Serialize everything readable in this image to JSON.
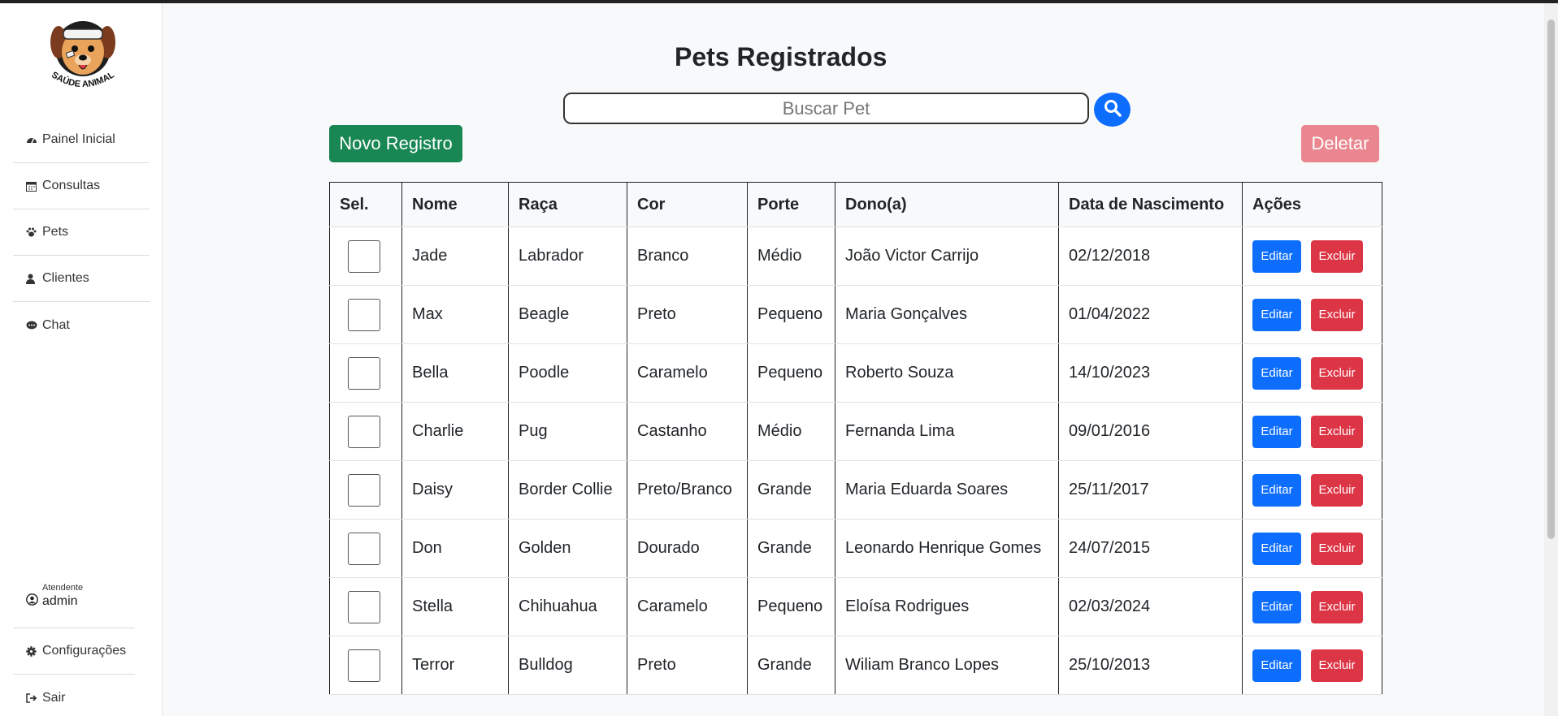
{
  "brand": {
    "logo_text": "SAÚDE ANIMAL"
  },
  "sidebar": {
    "items": [
      {
        "label": "Painel Inicial",
        "icon": "dashboard-icon"
      },
      {
        "label": "Consultas",
        "icon": "calendar-icon"
      },
      {
        "label": "Pets",
        "icon": "paw-icon"
      },
      {
        "label": "Clientes",
        "icon": "user-icon"
      },
      {
        "label": "Chat",
        "icon": "chat-icon"
      }
    ],
    "user": {
      "role": "Atendente",
      "name": "admin"
    },
    "bottom": [
      {
        "label": "Configurações",
        "icon": "gear-icon"
      },
      {
        "label": "Sair",
        "icon": "logout-icon"
      }
    ]
  },
  "main": {
    "title": "Pets Registrados",
    "search": {
      "placeholder": "Buscar Pet"
    },
    "new_label": "Novo Registro",
    "delete_label": "Deletar"
  },
  "table": {
    "headers": [
      "Sel.",
      "Nome",
      "Raça",
      "Cor",
      "Porte",
      "Dono(a)",
      "Data de Nascimento",
      "Ações"
    ],
    "edit_label": "Editar",
    "delete_label": "Excluir",
    "rows": [
      {
        "nome": "Jade",
        "raca": "Labrador",
        "cor": "Branco",
        "porte": "Médio",
        "dono": "João Victor Carrijo",
        "nascimento": "02/12/2018"
      },
      {
        "nome": "Max",
        "raca": "Beagle",
        "cor": "Preto",
        "porte": "Pequeno",
        "dono": "Maria Gonçalves",
        "nascimento": "01/04/2022"
      },
      {
        "nome": "Bella",
        "raca": "Poodle",
        "cor": "Caramelo",
        "porte": "Pequeno",
        "dono": "Roberto Souza",
        "nascimento": "14/10/2023"
      },
      {
        "nome": "Charlie",
        "raca": "Pug",
        "cor": "Castanho",
        "porte": "Médio",
        "dono": "Fernanda Lima",
        "nascimento": "09/01/2016"
      },
      {
        "nome": "Daisy",
        "raca": "Border Collie",
        "cor": "Preto/Branco",
        "porte": "Grande",
        "dono": "Maria Eduarda Soares",
        "nascimento": "25/11/2017"
      },
      {
        "nome": "Don",
        "raca": "Golden",
        "cor": "Dourado",
        "porte": "Grande",
        "dono": "Leonardo Henrique Gomes",
        "nascimento": "24/07/2015"
      },
      {
        "nome": "Stella",
        "raca": "Chihuahua",
        "cor": "Caramelo",
        "porte": "Pequeno",
        "dono": "Eloísa Rodrigues",
        "nascimento": "02/03/2024"
      },
      {
        "nome": "Terror",
        "raca": "Bulldog",
        "cor": "Preto",
        "porte": "Grande",
        "dono": "Wiliam Branco Lopes",
        "nascimento": "25/10/2013"
      }
    ]
  }
}
